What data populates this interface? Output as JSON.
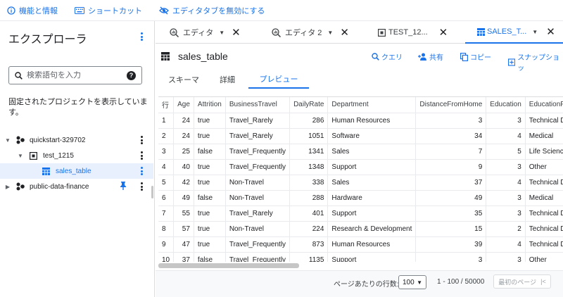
{
  "topbar": {
    "info_label": "機能と情報",
    "shortcut_label": "ショートカット",
    "disable_tabs_label": "エディタタブを無効にする"
  },
  "explorer": {
    "title": "エクスプローラ",
    "search_placeholder": "検索語句を入力",
    "pinned_message": "固定されたプロジェクトを表示しています。",
    "tree": [
      {
        "label": "quickstart-329702"
      },
      {
        "label": "test_1215"
      },
      {
        "label": "sales_table"
      },
      {
        "label": "public-data-finance"
      }
    ]
  },
  "tabs": [
    {
      "label": "エディタ"
    },
    {
      "label": "エディタ 2"
    },
    {
      "label": "TEST_12..."
    },
    {
      "label": "SALES_T..."
    }
  ],
  "table_header": {
    "title": "sales_table",
    "actions": {
      "query": "クエリ",
      "share": "共有",
      "copy": "コピー",
      "snapshot": "スナップショッ"
    }
  },
  "subtabs": {
    "schema": "スキーマ",
    "details": "詳細",
    "preview": "プレビュー"
  },
  "grid": {
    "columns": [
      "行",
      "Age",
      "Attrition",
      "BusinessTravel",
      "DailyRate",
      "Department",
      "DistanceFromHome",
      "Education",
      "EducationField"
    ],
    "rows": [
      [
        "1",
        "24",
        "true",
        "Travel_Rarely",
        "286",
        "Human Resources",
        "3",
        "3",
        "Technical Degre"
      ],
      [
        "2",
        "24",
        "true",
        "Travel_Rarely",
        "1051",
        "Software",
        "34",
        "4",
        "Medical"
      ],
      [
        "3",
        "25",
        "false",
        "Travel_Frequently",
        "1341",
        "Sales",
        "7",
        "5",
        "Life Sciences"
      ],
      [
        "4",
        "40",
        "true",
        "Travel_Frequently",
        "1348",
        "Support",
        "9",
        "3",
        "Other"
      ],
      [
        "5",
        "42",
        "true",
        "Non-Travel",
        "338",
        "Sales",
        "37",
        "4",
        "Technical Degre"
      ],
      [
        "6",
        "49",
        "false",
        "Non-Travel",
        "288",
        "Hardware",
        "49",
        "3",
        "Medical"
      ],
      [
        "7",
        "55",
        "true",
        "Travel_Rarely",
        "401",
        "Support",
        "35",
        "3",
        "Technical Degre"
      ],
      [
        "8",
        "57",
        "true",
        "Non-Travel",
        "224",
        "Research & Development",
        "15",
        "2",
        "Technical Degre"
      ],
      [
        "9",
        "47",
        "true",
        "Travel_Frequently",
        "873",
        "Human Resources",
        "39",
        "4",
        "Technical Degre"
      ],
      [
        "10",
        "37",
        "false",
        "Travel_Frequently",
        "1135",
        "Support",
        "3",
        "3",
        "Other"
      ]
    ]
  },
  "pagination": {
    "rows_per_page_label": "ページあたりの行数:",
    "rows_per_page_value": "100",
    "range": "1 - 100 / 50000",
    "last_page_label": "最初のページ"
  },
  "colors": {
    "accent": "#1a73e8",
    "selected_bg": "#e8f0fe",
    "text": "#202124"
  }
}
